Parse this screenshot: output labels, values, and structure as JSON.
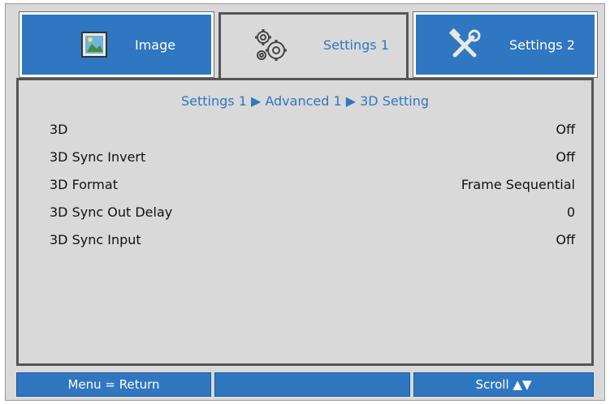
{
  "tabs": [
    {
      "label": "Image",
      "icon": "image-icon"
    },
    {
      "label": "Settings 1",
      "icon": "gears-icon"
    },
    {
      "label": "Settings 2",
      "icon": "tools-icon"
    }
  ],
  "breadcrumb": "Settings 1 ▶ Advanced 1 ▶ 3D Setting",
  "rows": [
    {
      "label": "3D",
      "value": "Off"
    },
    {
      "label": "3D Sync Invert",
      "value": "Off"
    },
    {
      "label": "3D Format",
      "value": "Frame Sequential"
    },
    {
      "label": "3D Sync Out Delay",
      "value": "0"
    },
    {
      "label": "3D Sync Input",
      "value": "Off"
    }
  ],
  "footer": {
    "left": "Menu = Return",
    "middle": "",
    "right": "Scroll ▲▼"
  },
  "colors": {
    "accent": "#2f77c0",
    "background": "#d9d9d9",
    "border": "#555555"
  }
}
